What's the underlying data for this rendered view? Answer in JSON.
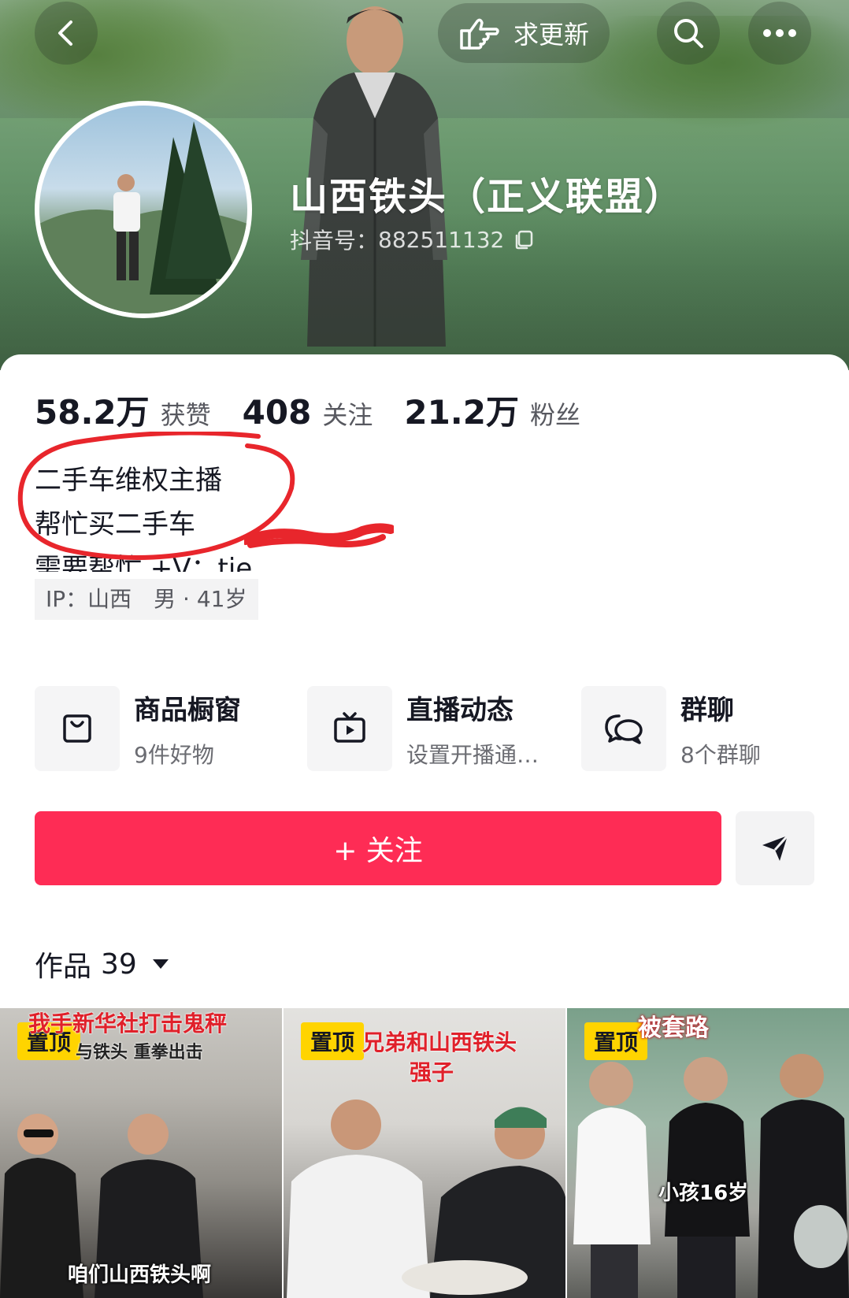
{
  "header": {
    "update_button_label": "求更新",
    "display_name": "山西铁头（正义联盟）",
    "douyin_id_label": "抖音号：",
    "douyin_id_value": "882511132"
  },
  "stats": [
    {
      "value": "58.2万",
      "label": "获赞"
    },
    {
      "value": "408",
      "label": "关注"
    },
    {
      "value": "21.2万",
      "label": "粉丝"
    }
  ],
  "bio": {
    "line1": "二手车维权主播",
    "line2": "帮忙买二手车",
    "line3": "需要帮忙 +V：tie"
  },
  "tags": {
    "ip": "IP：山西",
    "gender_age": "男 · 41岁"
  },
  "entries": [
    {
      "title": "商品橱窗",
      "subtitle": "9件好物",
      "icon": "shopping-bag-icon"
    },
    {
      "title": "直播动态",
      "subtitle": "设置开播通…",
      "icon": "tv-icon"
    },
    {
      "title": "群聊",
      "subtitle": "8个群聊",
      "icon": "chat-bubbles-icon"
    }
  ],
  "follow_button_label": "+ 关注",
  "works": {
    "tab_label": "作品",
    "count": "39"
  },
  "videos": [
    {
      "pin": "置顶",
      "overlay_top": "我手新华社打击鬼秤",
      "overlay_sub": "与铁头 重拳出击",
      "overlay_bottom": "咱们山西铁头啊"
    },
    {
      "pin": "置顶",
      "overlay_top": "兄弟和山西铁头",
      "overlay_sub": "强子"
    },
    {
      "pin": "置顶",
      "overlay_top": "被套路",
      "overlay_sub": "小孩16岁"
    }
  ],
  "colors": {
    "accent": "#fe2c55",
    "pin": "#ffd400",
    "annotation_circle": "#e8262c"
  }
}
